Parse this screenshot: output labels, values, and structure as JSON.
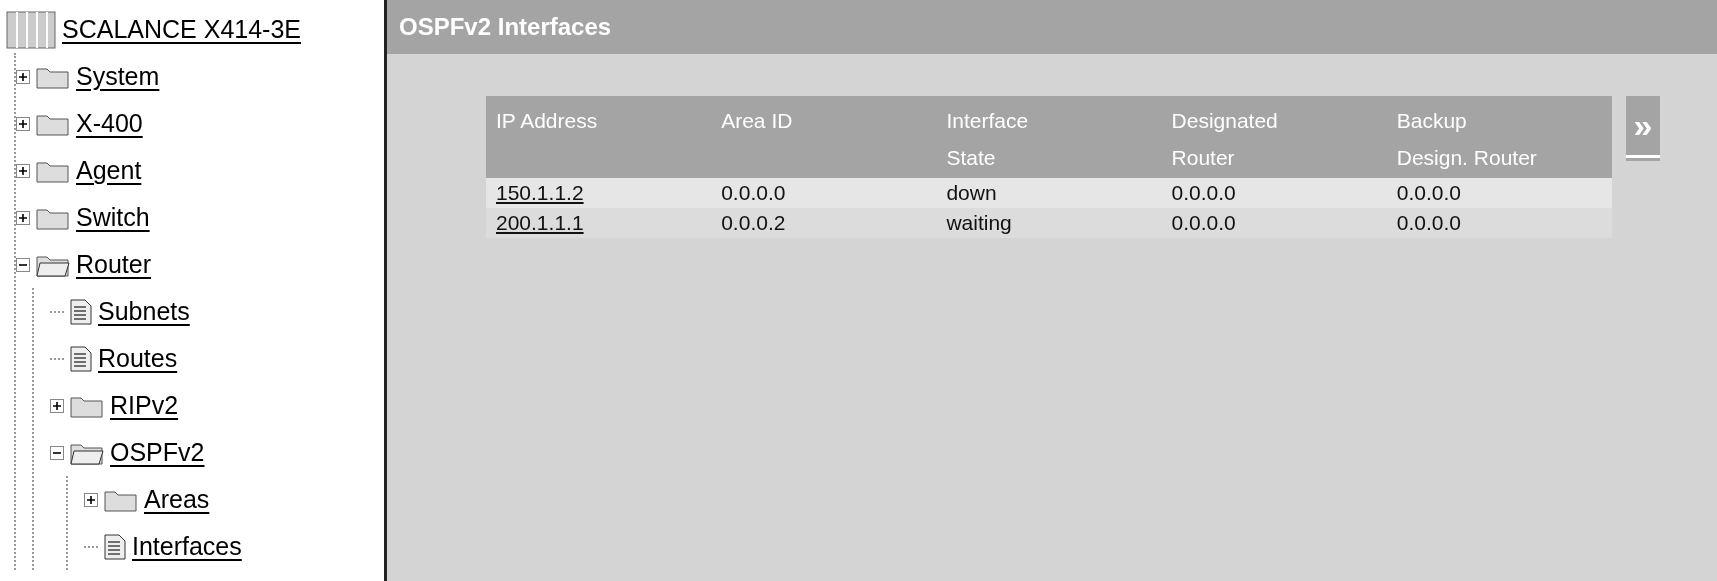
{
  "sidebar": {
    "root": {
      "label": "SCALANCE X414-3E"
    },
    "items": [
      {
        "kind": "folder",
        "label": "System",
        "expanded": false
      },
      {
        "kind": "folder",
        "label": "X-400",
        "expanded": false
      },
      {
        "kind": "folder",
        "label": "Agent",
        "expanded": false
      },
      {
        "kind": "folder",
        "label": "Switch",
        "expanded": false
      },
      {
        "kind": "folder",
        "label": "Router",
        "expanded": true,
        "children": [
          {
            "kind": "page",
            "label": "Subnets"
          },
          {
            "kind": "page",
            "label": "Routes"
          },
          {
            "kind": "folder",
            "label": "RIPv2",
            "expanded": false
          },
          {
            "kind": "folder",
            "label": "OSPFv2",
            "expanded": true,
            "children": [
              {
                "kind": "folder",
                "label": "Areas",
                "expanded": false
              },
              {
                "kind": "page",
                "label": "Interfaces"
              }
            ]
          }
        ]
      }
    ]
  },
  "page": {
    "title": "OSPFv2 Interfaces"
  },
  "table": {
    "columns": [
      "IP Address",
      "Area ID",
      "Interface\nState",
      "Designated\nRouter",
      "Backup\nDesign. Router"
    ],
    "rows": [
      [
        "150.1.1.2",
        "0.0.0.0",
        "down",
        "0.0.0.0",
        "0.0.0.0"
      ],
      [
        "200.1.1.1",
        "0.0.0.2",
        "waiting",
        "0.0.0.0",
        "0.0.0.0"
      ]
    ]
  },
  "next_button": {
    "label": "»"
  }
}
